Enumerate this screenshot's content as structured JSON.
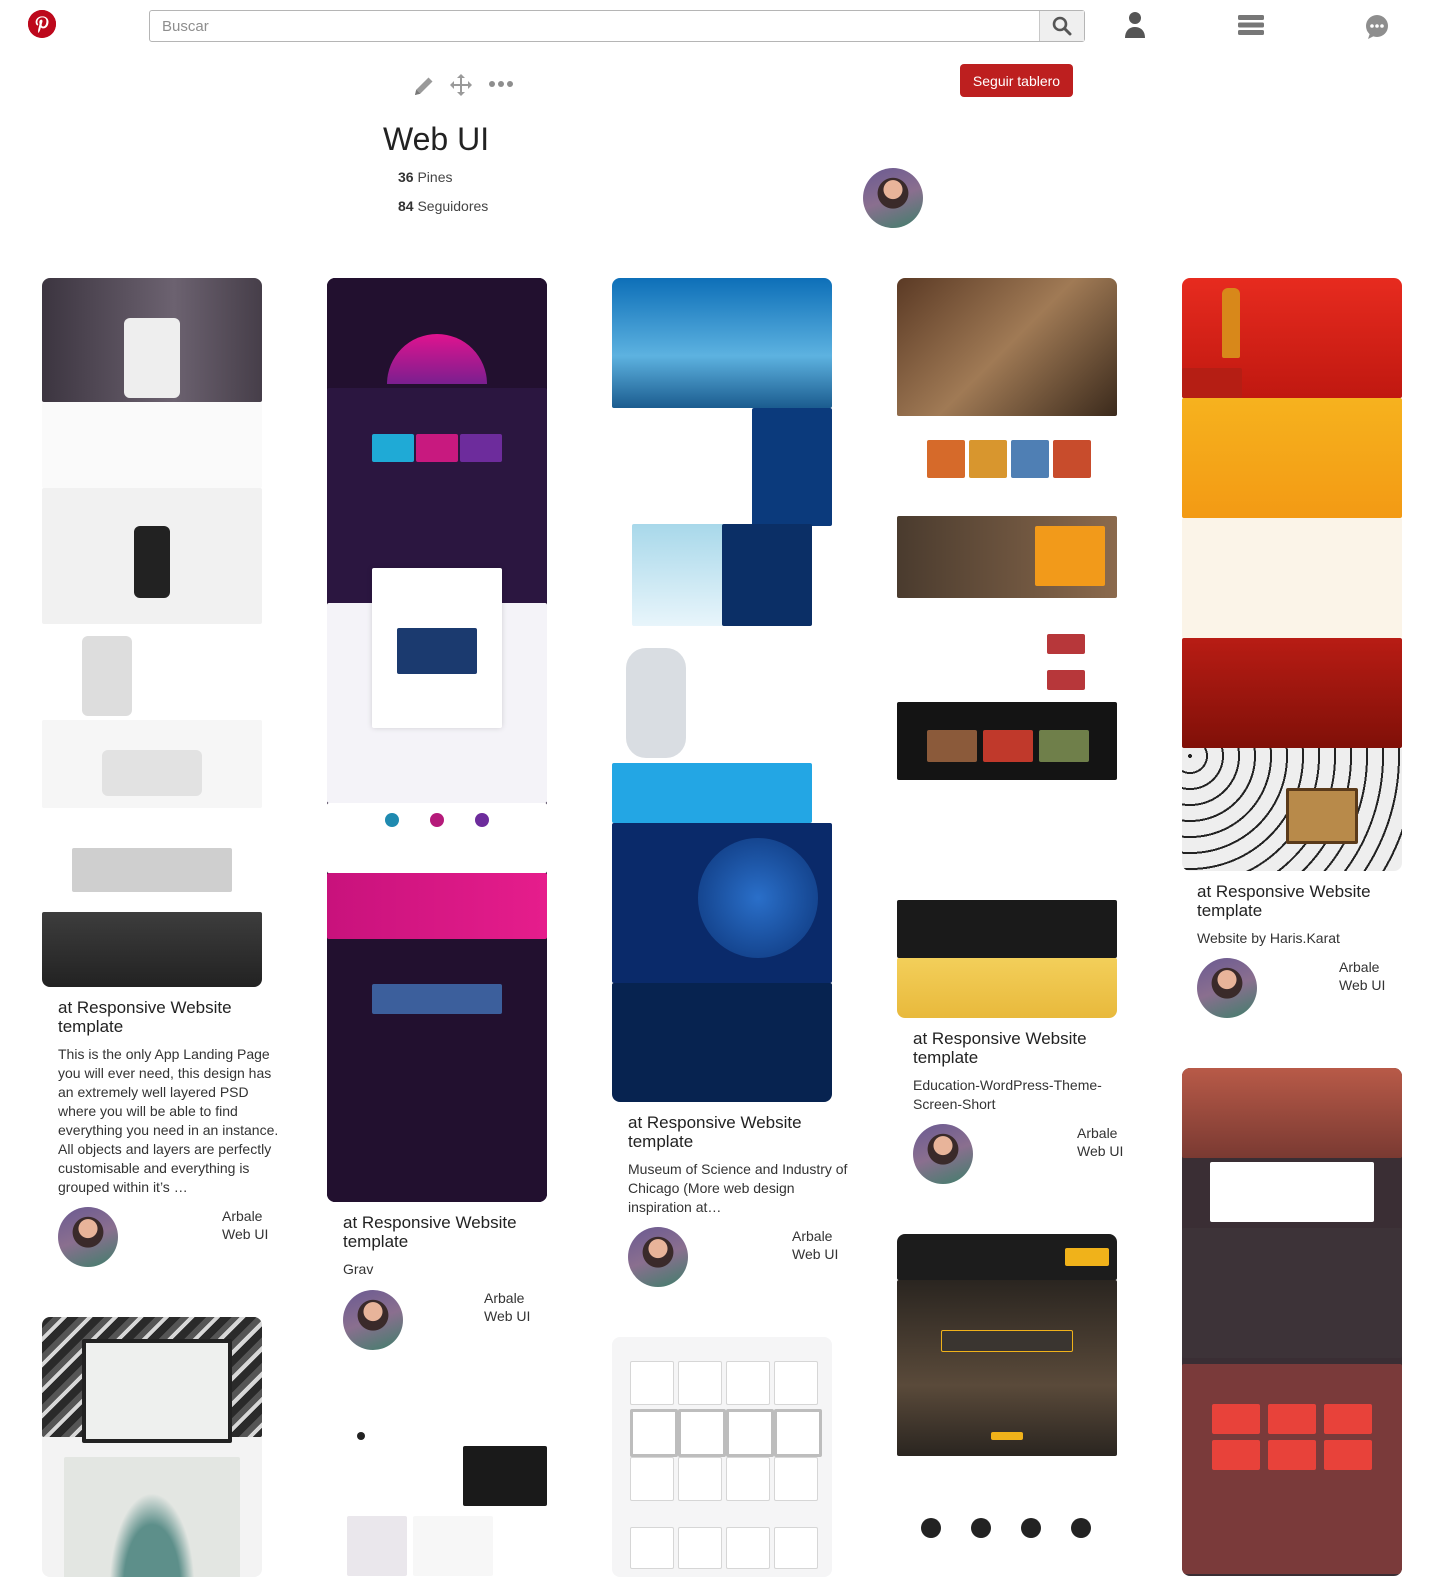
{
  "header": {
    "search_placeholder": "Buscar"
  },
  "board": {
    "title": "Web UI",
    "pins_count": "36",
    "pins_label": "Pines",
    "followers_count": "84",
    "followers_label": "Seguidores",
    "follow_button": "Seguir tablero"
  },
  "colors": {
    "brand": "#bd081c",
    "follow_button": "#bd1f1f"
  },
  "icons": [
    "pinterest-logo-icon",
    "search-icon",
    "user-icon",
    "menu-icon",
    "chat-icon",
    "edit-icon",
    "move-icon",
    "more-icon"
  ],
  "pins": [
    {
      "title": "at Responsive Website template",
      "description": "This is the only App Landing Page you will ever need, this design has an extremely well layered PSD where you will be able to find everything you need in an instance. All objects and layers are perfectly customisable and everything is grouped within it’s …",
      "user": "Arbale Web UI"
    },
    {
      "title": "at Responsive Website template",
      "description": "Grav",
      "user": "Arbale Web UI"
    },
    {
      "title": "at Responsive Website template",
      "description": "Museum of Science and Industry of Chicago (More web design inspiration at…",
      "user": "Arbale Web UI"
    },
    {
      "title": "at Responsive Website template",
      "description": "Education-WordPress-Theme-Screen-Short",
      "user": "Arbale Web UI"
    },
    {
      "title": "at Responsive Website template",
      "description": "Website by Haris.Karat",
      "user": "Arbale Web UI"
    }
  ]
}
